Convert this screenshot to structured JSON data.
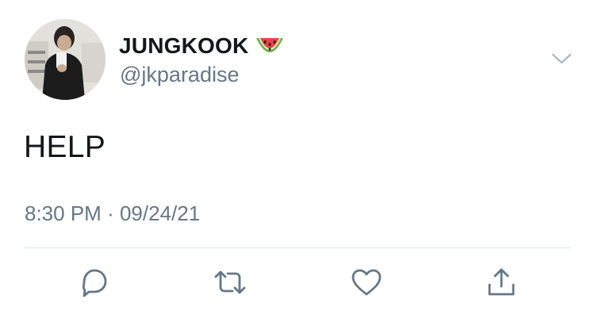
{
  "author": {
    "display_name": "JUNGKOOK",
    "handle": "@jkparadise",
    "name_emoji": "watermelon-icon",
    "avatar": "avatar"
  },
  "tweet": {
    "text": "HELP",
    "time": "8:30 PM",
    "separator": "·",
    "date": "09/24/21"
  },
  "menu": {
    "icon": "chevron-down-icon"
  },
  "actions": [
    {
      "name": "reply",
      "icon": "reply-icon"
    },
    {
      "name": "retweet",
      "icon": "retweet-icon"
    },
    {
      "name": "like",
      "icon": "heart-icon"
    },
    {
      "name": "share",
      "icon": "share-icon"
    }
  ],
  "colors": {
    "text_primary": "#14171a",
    "text_secondary": "#657786",
    "divider": "#e1e8ed",
    "icon": "#657786"
  }
}
